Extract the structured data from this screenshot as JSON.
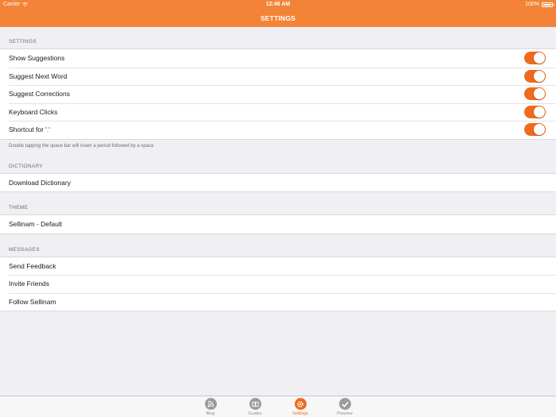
{
  "status_bar": {
    "carrier": "Carrier",
    "time": "12:48 AM",
    "battery": "100%"
  },
  "nav": {
    "title": "SETTINGS"
  },
  "colors": {
    "accent": "#f06a1d",
    "bar": "#f38437",
    "background": "#efeff4"
  },
  "sections": {
    "settings": {
      "header": "SETTINGS",
      "rows": [
        {
          "label": "Show Suggestions",
          "toggle": true
        },
        {
          "label": "Suggest Next Word",
          "toggle": true
        },
        {
          "label": "Suggest Corrections",
          "toggle": true
        },
        {
          "label": "Keyboard Clicks",
          "toggle": true
        },
        {
          "label": "Shortcut for '.'",
          "toggle": true
        }
      ],
      "footer": "Double tapping the space bar will insert a period followed by a space"
    },
    "dictionary": {
      "header": "DICTIONARY",
      "rows": [
        {
          "label": "Download Dictionary"
        }
      ]
    },
    "theme": {
      "header": "THEME",
      "rows": [
        {
          "label": "Sellinam - Default"
        }
      ]
    },
    "messages": {
      "header": "MESSAGES",
      "rows": [
        {
          "label": "Send Feedback"
        },
        {
          "label": "Invite Friends"
        },
        {
          "label": "Follow Sellinam"
        }
      ]
    }
  },
  "tabs": [
    {
      "label": "Blog",
      "icon": "rss-icon",
      "active": false
    },
    {
      "label": "Guides",
      "icon": "book-icon",
      "active": false
    },
    {
      "label": "Settings",
      "icon": "gear-icon",
      "active": true
    },
    {
      "label": "Preview",
      "icon": "checkmark-icon",
      "active": false
    }
  ]
}
